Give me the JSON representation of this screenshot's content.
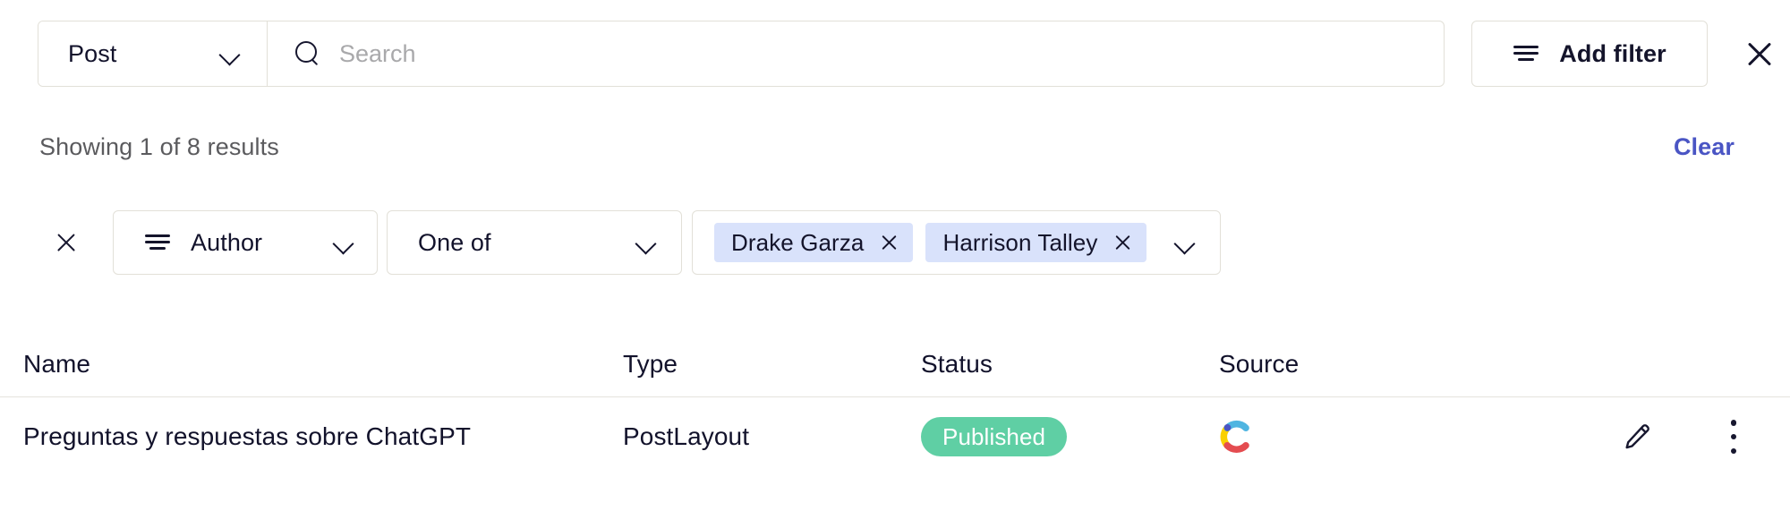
{
  "searchbar": {
    "type_select": {
      "label": "Post",
      "chevron_icon": "chevron-down-icon"
    },
    "search": {
      "value": "",
      "placeholder": "Search",
      "icon": "search-icon"
    },
    "add_filter": {
      "label": "Add filter",
      "icon": "filter-lines-icon"
    },
    "close": {
      "icon": "close-icon"
    }
  },
  "results": {
    "summary": "Showing 1 of 8 results",
    "clear_label": "Clear"
  },
  "filter": {
    "remove_icon": "close-icon",
    "field": {
      "label": "Author",
      "icon": "filter-lines-icon",
      "chevron_icon": "chevron-down-icon"
    },
    "operator": {
      "label": "One of",
      "chevron_icon": "chevron-down-icon"
    },
    "values": [
      {
        "label": "Drake Garza",
        "remove_icon": "close-icon"
      },
      {
        "label": "Harrison Talley",
        "remove_icon": "close-icon"
      }
    ],
    "values_chevron_icon": "chevron-down-icon"
  },
  "table": {
    "columns": [
      "Name",
      "Type",
      "Status",
      "Source"
    ],
    "rows": [
      {
        "name": "Preguntas y respuestas sobre ChatGPT",
        "type": "PostLayout",
        "status": "Published",
        "source_icon": "contentful-logo-icon",
        "edit_icon": "pencil-icon",
        "more_icon": "kebab-menu-icon"
      }
    ]
  },
  "colors": {
    "accent_link": "#4a55c4",
    "status_published_bg": "#5fcfa4",
    "chip_bg": "#d9e2fb",
    "border": "#e2e0d8",
    "text_primary": "#12122b",
    "text_muted": "#5b5b5e"
  }
}
